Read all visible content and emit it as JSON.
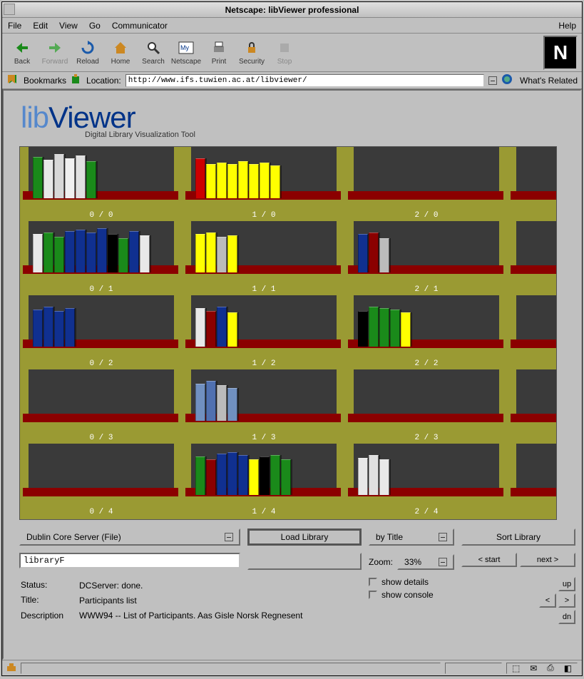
{
  "window": {
    "title": "Netscape: libViewer professional"
  },
  "menu": {
    "file": "File",
    "edit": "Edit",
    "view": "View",
    "go": "Go",
    "comm": "Communicator",
    "help": "Help"
  },
  "toolbar": {
    "back": "Back",
    "forward": "Forward",
    "reload": "Reload",
    "home": "Home",
    "search": "Search",
    "netscape": "Netscape",
    "print": "Print",
    "security": "Security",
    "stop": "Stop"
  },
  "location": {
    "bookmarks": "Bookmarks",
    "label": "Location:",
    "url": "http://www.ifs.tuwien.ac.at/libviewer/",
    "related": "What's Related"
  },
  "logo": {
    "lib": "lib",
    "viewer": "Viewer",
    "sub": "Digital Library Visualization Tool"
  },
  "shelves": [
    [
      {
        "label": "0 / 0",
        "books": [
          [
            "#1a8a1a",
            58
          ],
          [
            "#e8e8e8",
            54
          ],
          [
            "#d8d8d8",
            62
          ],
          [
            "#f0f0f0",
            56
          ],
          [
            "#e0e0e0",
            60
          ],
          [
            "#1a8a1a",
            52
          ]
        ]
      },
      {
        "label": "1 / 0",
        "books": [
          [
            "#cc0000",
            56
          ],
          [
            "#ffff00",
            48
          ],
          [
            "#ffff00",
            50
          ],
          [
            "#ffff00",
            48
          ],
          [
            "#ffff00",
            52
          ],
          [
            "#ffff00",
            48
          ],
          [
            "#ffff00",
            50
          ],
          [
            "#ffff00",
            46
          ]
        ]
      },
      {
        "label": "2 / 0",
        "books": []
      }
    ],
    [
      {
        "label": "0 / 1",
        "books": [
          [
            "#e8e8e8",
            54
          ],
          [
            "#1a8a1a",
            56
          ],
          [
            "#1a8a1a",
            50
          ],
          [
            "#103090",
            58
          ],
          [
            "#103090",
            60
          ],
          [
            "#103090",
            56
          ],
          [
            "#103090",
            62
          ],
          [
            "#000000",
            54
          ],
          [
            "#1a8a1a",
            48
          ],
          [
            "#103090",
            58
          ],
          [
            "#e8e8e8",
            52
          ]
        ]
      },
      {
        "label": "1 / 1",
        "books": [
          [
            "#ffff00",
            54
          ],
          [
            "#ffff00",
            56
          ],
          [
            "#bbbbbb",
            50
          ],
          [
            "#ffff00",
            52
          ]
        ]
      },
      {
        "label": "2 / 1",
        "books": [
          [
            "#103090",
            54
          ],
          [
            "#8b0000",
            56
          ],
          [
            "#bbbbbb",
            48
          ]
        ]
      }
    ],
    [
      {
        "label": "0 / 2",
        "books": [
          [
            "#103090",
            52
          ],
          [
            "#103090",
            56
          ],
          [
            "#103090",
            50
          ],
          [
            "#103090",
            54
          ]
        ]
      },
      {
        "label": "1 / 2",
        "books": [
          [
            "#e8e8e8",
            54
          ],
          [
            "#8b0000",
            50
          ],
          [
            "#103090",
            56
          ],
          [
            "#ffff00",
            48
          ]
        ]
      },
      {
        "label": "2 / 2",
        "books": [
          [
            "#000000",
            50
          ],
          [
            "#1a8a1a",
            56
          ],
          [
            "#1a8a1a",
            54
          ],
          [
            "#1a8a1a",
            52
          ],
          [
            "#ffff00",
            48
          ]
        ]
      }
    ],
    [
      {
        "label": "0 / 3",
        "books": []
      },
      {
        "label": "1 / 3",
        "books": [
          [
            "#7090c0",
            52
          ],
          [
            "#5070b0",
            56
          ],
          [
            "#bbbbbb",
            50
          ],
          [
            "#7090c0",
            46
          ]
        ]
      },
      {
        "label": "2 / 3",
        "books": []
      }
    ],
    [
      {
        "label": "0 / 4",
        "books": []
      },
      {
        "label": "1 / 4",
        "books": [
          [
            "#1a8a1a",
            54
          ],
          [
            "#8b0000",
            50
          ],
          [
            "#103090",
            58
          ],
          [
            "#103090",
            60
          ],
          [
            "#103090",
            56
          ],
          [
            "#ffff00",
            50
          ],
          [
            "#000000",
            54
          ],
          [
            "#1a8a1a",
            56
          ],
          [
            "#1a8a1a",
            50
          ]
        ]
      },
      {
        "label": "2 / 4",
        "books": [
          [
            "#e8e8e8",
            52
          ],
          [
            "#e0e0e0",
            56
          ],
          [
            "#e8e8e8",
            50
          ]
        ]
      }
    ]
  ],
  "controls": {
    "server": "Dublin Core Server (File)",
    "load": "Load Library",
    "sortby": "by Title",
    "sort": "Sort Library",
    "input": "libraryF",
    "zoom_label": "Zoom:",
    "zoom_value": "33%",
    "start": "< start",
    "next": "next >",
    "show_details": "show details",
    "show_console": "show console",
    "up": "up",
    "left": "<",
    "right": ">",
    "down": "dn"
  },
  "status": {
    "status_k": "Status:",
    "status_v": "DCServer: done.",
    "title_k": "Title:",
    "title_v": "Participants list",
    "desc_k": "Description",
    "desc_v": "WWW94 -- List of Participants. Aas Gisle Norsk Regnesent"
  }
}
